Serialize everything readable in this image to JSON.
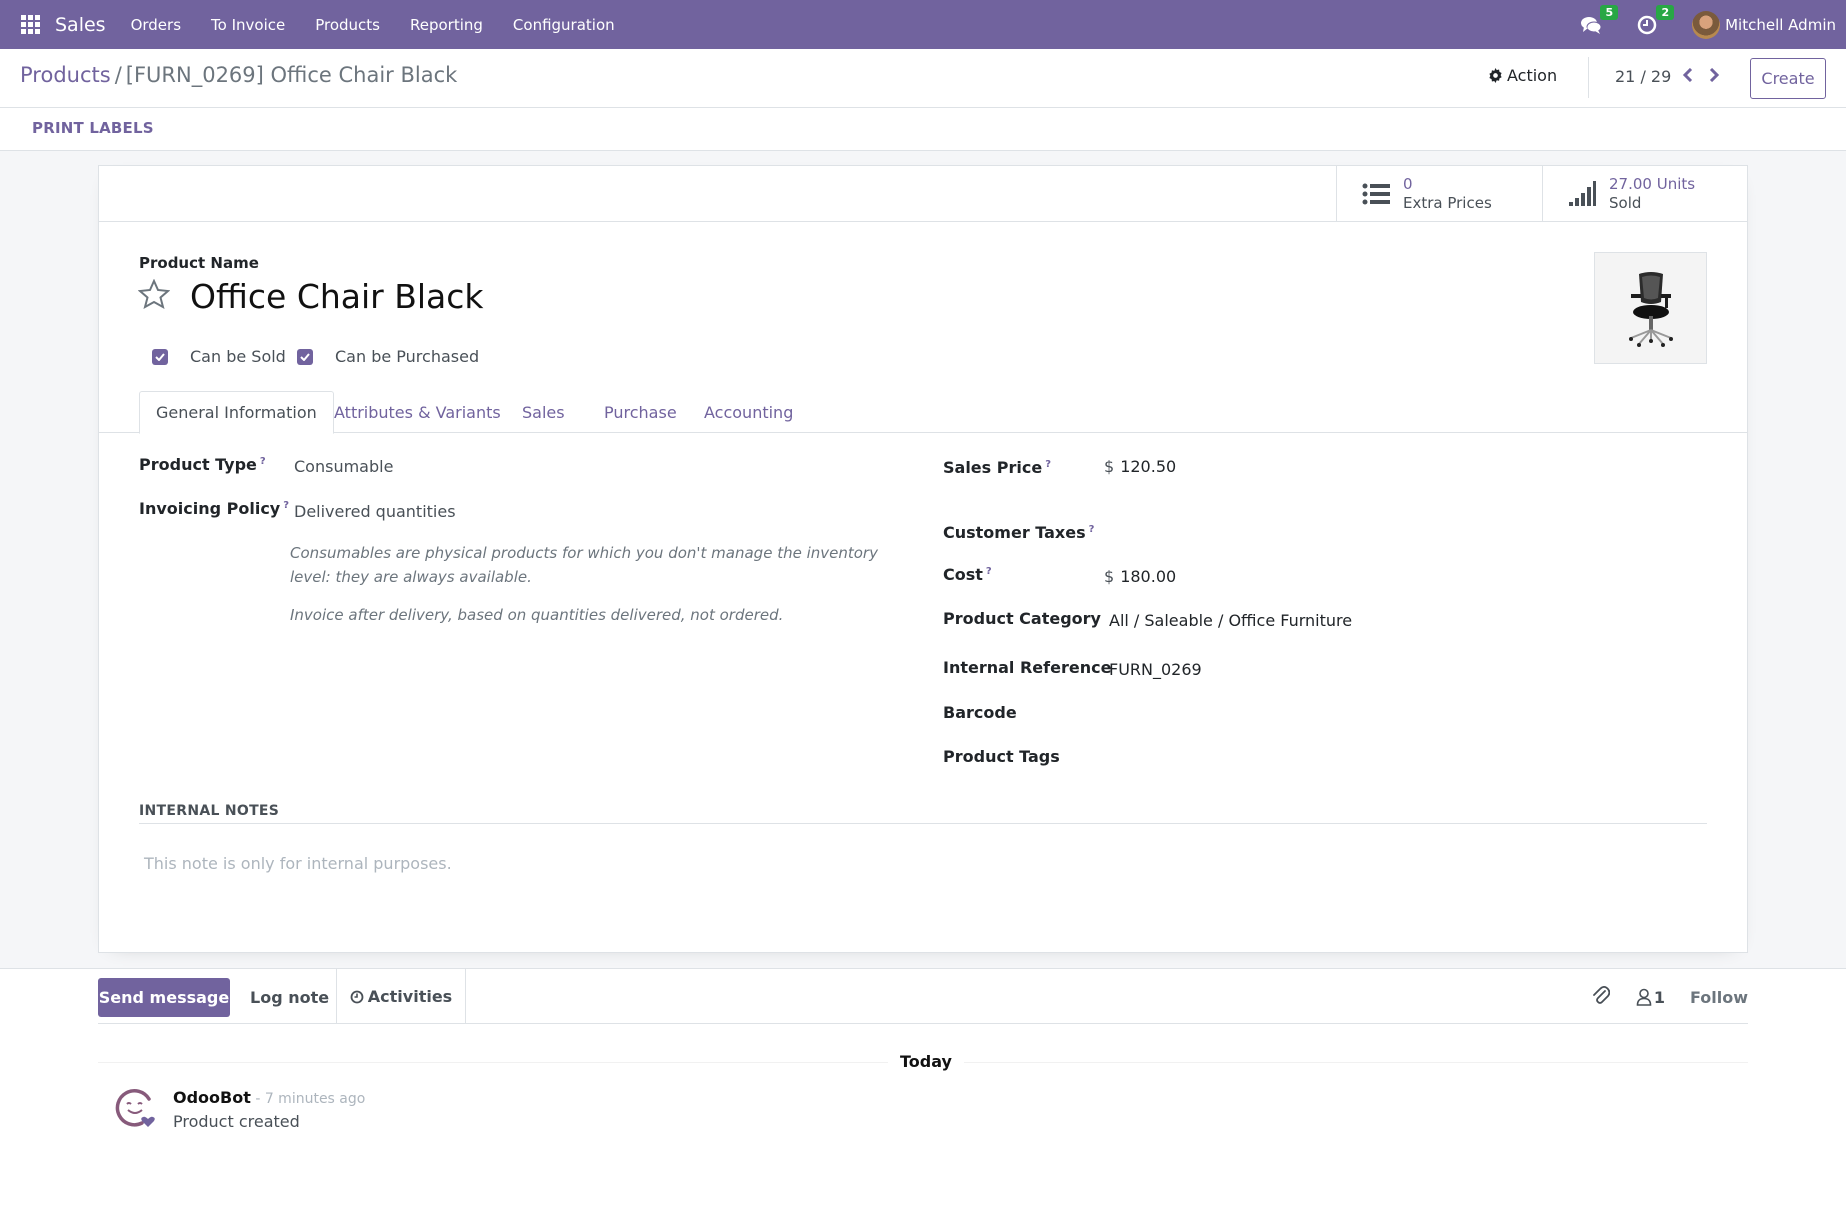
{
  "navbar": {
    "app_name": "Sales",
    "menu": [
      "Orders",
      "To Invoice",
      "Products",
      "Reporting",
      "Configuration"
    ],
    "messages_count": "5",
    "activities_count": "2",
    "user_name": "Mitchell Admin"
  },
  "control_panel": {
    "breadcrumb_parent": "Products",
    "breadcrumb_separator": "/",
    "breadcrumb_current": "[FURN_0269] Office Chair Black",
    "action_label": "Action",
    "pager": "21 / 29",
    "create_label": "Create"
  },
  "statusbar": {
    "print_labels": "PRINT LABELS"
  },
  "stat_buttons": [
    {
      "icon": "list-icon",
      "value": "0",
      "label": "Extra Prices"
    },
    {
      "icon": "signal-icon",
      "value": "27.00 Units",
      "label": "Sold"
    }
  ],
  "product": {
    "name_label": "Product Name",
    "name": "Office Chair Black",
    "can_be_sold_label": "Can be Sold",
    "can_be_sold": true,
    "can_be_purchased_label": "Can be Purchased",
    "can_be_purchased": true
  },
  "tabs": [
    {
      "label": "General Information",
      "active": true
    },
    {
      "label": "Attributes & Variants",
      "active": false
    },
    {
      "label": "Sales",
      "active": false
    },
    {
      "label": "Purchase",
      "active": false
    },
    {
      "label": "Accounting",
      "active": false
    }
  ],
  "general": {
    "product_type_label": "Product Type",
    "product_type": "Consumable",
    "invoicing_policy_label": "Invoicing Policy",
    "invoicing_policy": "Delivered quantities",
    "help_consumable": "Consumables are physical products for which you don't manage the inventory level: they are always available.",
    "help_invoice": "Invoice after delivery, based on quantities delivered, not ordered.",
    "help_marker": "?",
    "currency_symbol": "$",
    "sales_price_label": "Sales Price",
    "sales_price": "120.50",
    "customer_taxes_label": "Customer Taxes",
    "customer_taxes": "",
    "cost_label": "Cost",
    "cost": "180.00",
    "category_label": "Product Category",
    "category": "All / Saleable / Office Furniture",
    "internal_ref_label": "Internal Reference",
    "internal_ref": "FURN_0269",
    "barcode_label": "Barcode",
    "barcode": "",
    "tags_label": "Product Tags",
    "tags": ""
  },
  "internal_notes": {
    "title": "INTERNAL NOTES",
    "placeholder": "This note is only for internal purposes."
  },
  "chatter": {
    "send_message": "Send message",
    "log_note": "Log note",
    "activities": "Activities",
    "followers_count": "1",
    "follow": "Follow",
    "date_separator": "Today",
    "messages": [
      {
        "author": "OdooBot",
        "date": " - 7 minutes ago",
        "body": "Product created"
      }
    ]
  },
  "colors": {
    "brand": "#71639e",
    "badge": "#28a745"
  }
}
